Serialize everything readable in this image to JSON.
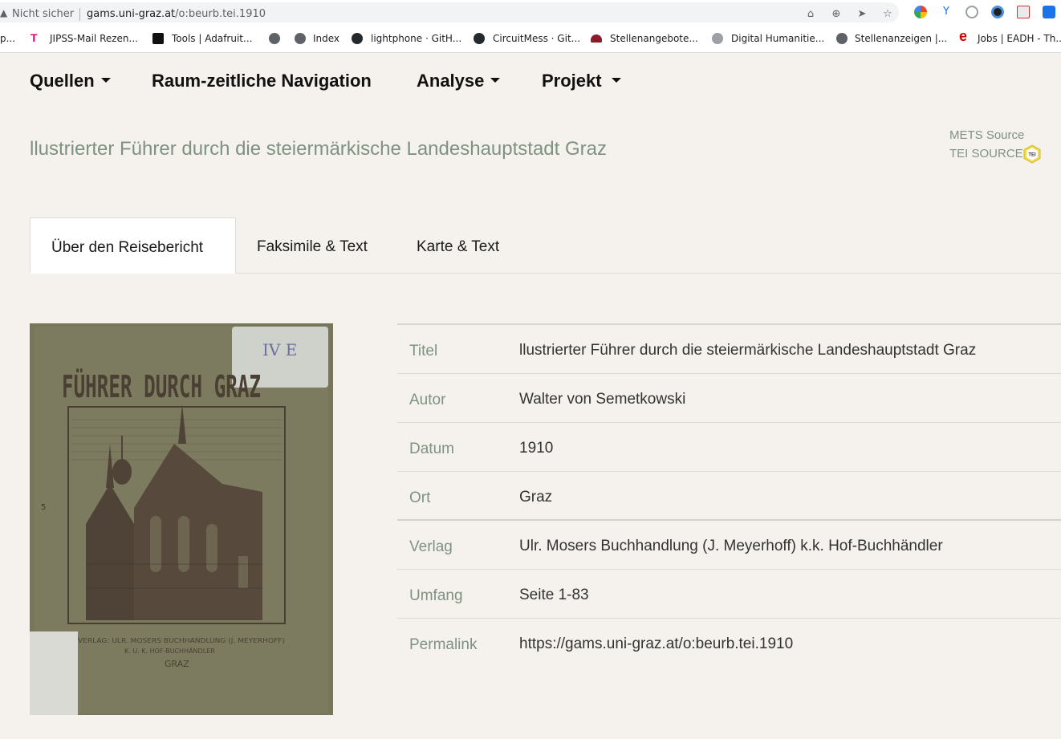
{
  "browser": {
    "security_label": "Nicht sicher",
    "url_domain": "gams.uni-graz.at",
    "url_path": "/o:beurb.tei.1910"
  },
  "bookmarks": [
    {
      "label": "p..."
    },
    {
      "label": "JIPSS-Mail Rezen..."
    },
    {
      "label": "Tools | Adafruit..."
    },
    {
      "label": ""
    },
    {
      "label": "Index"
    },
    {
      "label": "lightphone · GitH..."
    },
    {
      "label": "CircuitMess · Git..."
    },
    {
      "label": "Stellenangebote..."
    },
    {
      "label": "Digital Humanitie..."
    },
    {
      "label": "Stellenanzeigen |..."
    },
    {
      "label": "Jobs | EADH - Th..."
    }
  ],
  "nav": {
    "quellen": "Quellen",
    "raum": "Raum-zeitliche Navigation",
    "analyse": "Analyse",
    "projekt": "Projekt"
  },
  "header": {
    "title": "llustrierter Führer durch die steiermärkische Landeshauptstadt Graz",
    "mets_source": "METS Source",
    "tei_source": "TEI SOURCE",
    "tei_badge": "TEI"
  },
  "tabs": [
    {
      "label": "Über den Reisebericht",
      "active": true
    },
    {
      "label": "Faksimile & Text",
      "active": false
    },
    {
      "label": "Karte & Text",
      "active": false
    }
  ],
  "cover": {
    "shelf_mark": "IV E",
    "title": "FÜHRER DURCH GRAZ",
    "imprint_line1": "VERLAG: ULR. MOSERS BUCHHANDLUNG (J. MEYERHOFF)",
    "imprint_line2": "K. U. K. HOF-BUCHHÄNDLER",
    "imprint_line3": "GRAZ",
    "side_number": "5"
  },
  "metadata": [
    {
      "key": "Titel",
      "value": "llustrierter Führer durch die steiermärkische Landeshauptstadt Graz"
    },
    {
      "key": "Autor",
      "value": "Walter von Semetkowski"
    },
    {
      "key": "Datum",
      "value": "1910"
    },
    {
      "key": "Ort",
      "value": "Graz"
    },
    {
      "key": "Verlag",
      "value": "Ulr. Mosers Buchhandlung (J. Meyerhoff) k.k. Hof-Buchhändler"
    },
    {
      "key": "Umfang",
      "value": "Seite 1-83"
    },
    {
      "key": "Permalink",
      "value": "https://gams.uni-graz.at/o:beurb.tei.1910"
    }
  ]
}
